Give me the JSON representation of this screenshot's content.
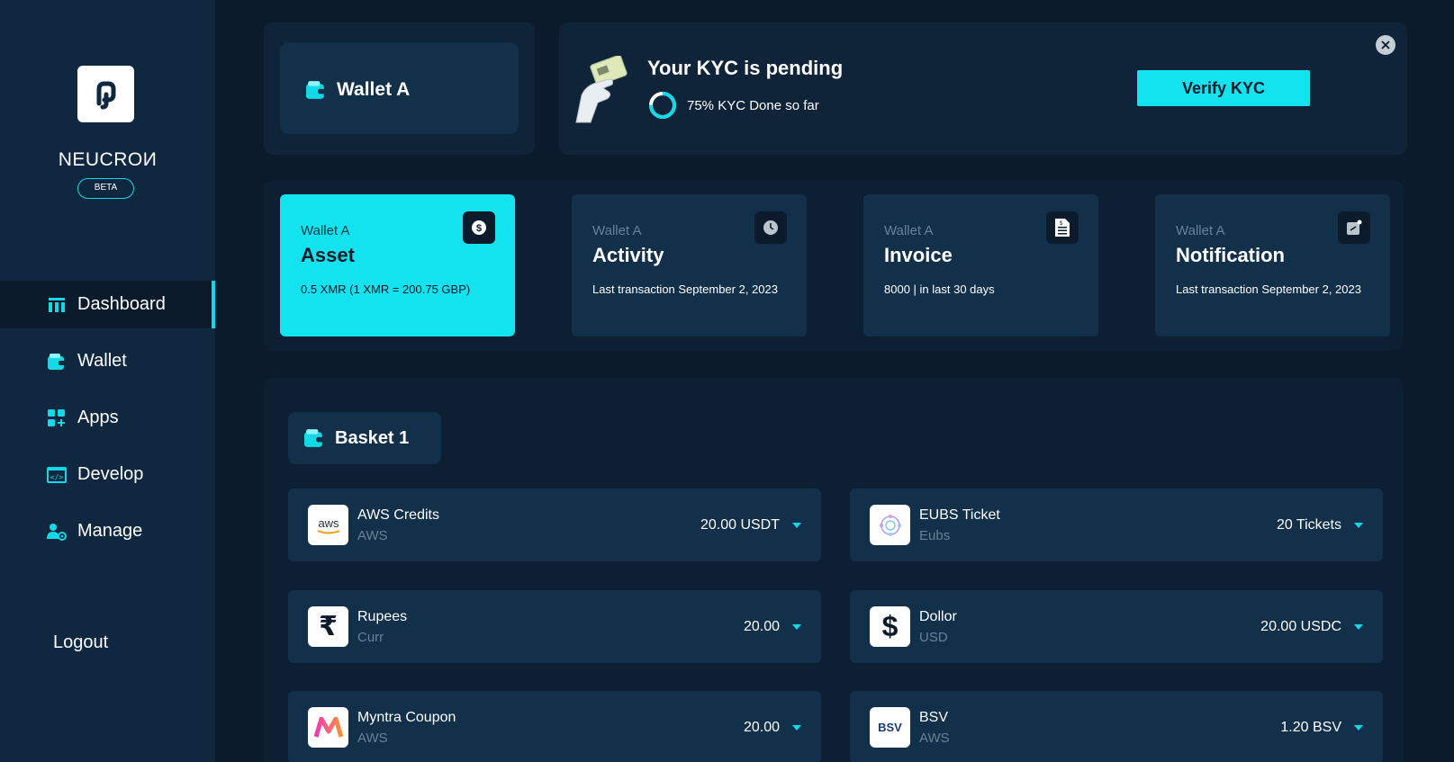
{
  "sidebar": {
    "brand": "NEUCROИ",
    "beta": "BETA",
    "items": [
      {
        "label": "Dashboard",
        "icon": "dashboard-icon",
        "active": true
      },
      {
        "label": "Wallet",
        "icon": "wallet-icon"
      },
      {
        "label": "Apps",
        "icon": "apps-icon"
      },
      {
        "label": "Develop",
        "icon": "code-icon"
      },
      {
        "label": "Manage",
        "icon": "user-settings-icon"
      }
    ],
    "logout": "Logout"
  },
  "wallet_card": {
    "label": "Wallet A"
  },
  "kyc": {
    "title": "Your KYC is pending",
    "progress_text": "75% KYC Done so far",
    "progress_value": 0.75,
    "button": "Verify KYC"
  },
  "stats": [
    {
      "sub": "Wallet A",
      "title": "Asset",
      "desc": "0.5 XMR (1 XMR = 200.75 GBP)",
      "icon": "dollar-icon"
    },
    {
      "sub": "Wallet A",
      "title": "Activity",
      "desc": "Last transaction September 2, 2023",
      "icon": "clock-icon"
    },
    {
      "sub": "Wallet A",
      "title": "Invoice",
      "desc": "8000 | in last 30 days",
      "icon": "invoice-icon"
    },
    {
      "sub": "Wallet A",
      "title": "Notification",
      "desc": "Last transaction September 2, 2023",
      "icon": "notification-icon"
    }
  ],
  "basket": {
    "label": "Basket 1",
    "assets": [
      {
        "name": "AWS Credits",
        "sub": "AWS",
        "amount": "20.00 USDT",
        "logo": "aws-logo"
      },
      {
        "name": "EUBS Ticket",
        "sub": "Eubs",
        "amount": "20 Tickets",
        "logo": "eubs-logo"
      },
      {
        "name": "Rupees",
        "sub": "Curr",
        "amount": "20.00",
        "logo": "rupee-logo"
      },
      {
        "name": "Dollor",
        "sub": "USD",
        "amount": "20.00 USDC",
        "logo": "dollar-logo"
      },
      {
        "name": "Myntra Coupon",
        "sub": "AWS",
        "amount": "20.00",
        "logo": "myntra-logo"
      },
      {
        "name": "BSV",
        "sub": "AWS",
        "amount": "1.20 BSV",
        "logo": "bsv-logo"
      }
    ],
    "logo_text": {
      "aws": "aws",
      "rupee": "₹",
      "dollar": "$",
      "bsv": "BSV"
    }
  },
  "colors": {
    "accent": "#13e3ee",
    "bg": "#0b1b2c",
    "sidebar": "#10283f",
    "card": "#13304a"
  }
}
